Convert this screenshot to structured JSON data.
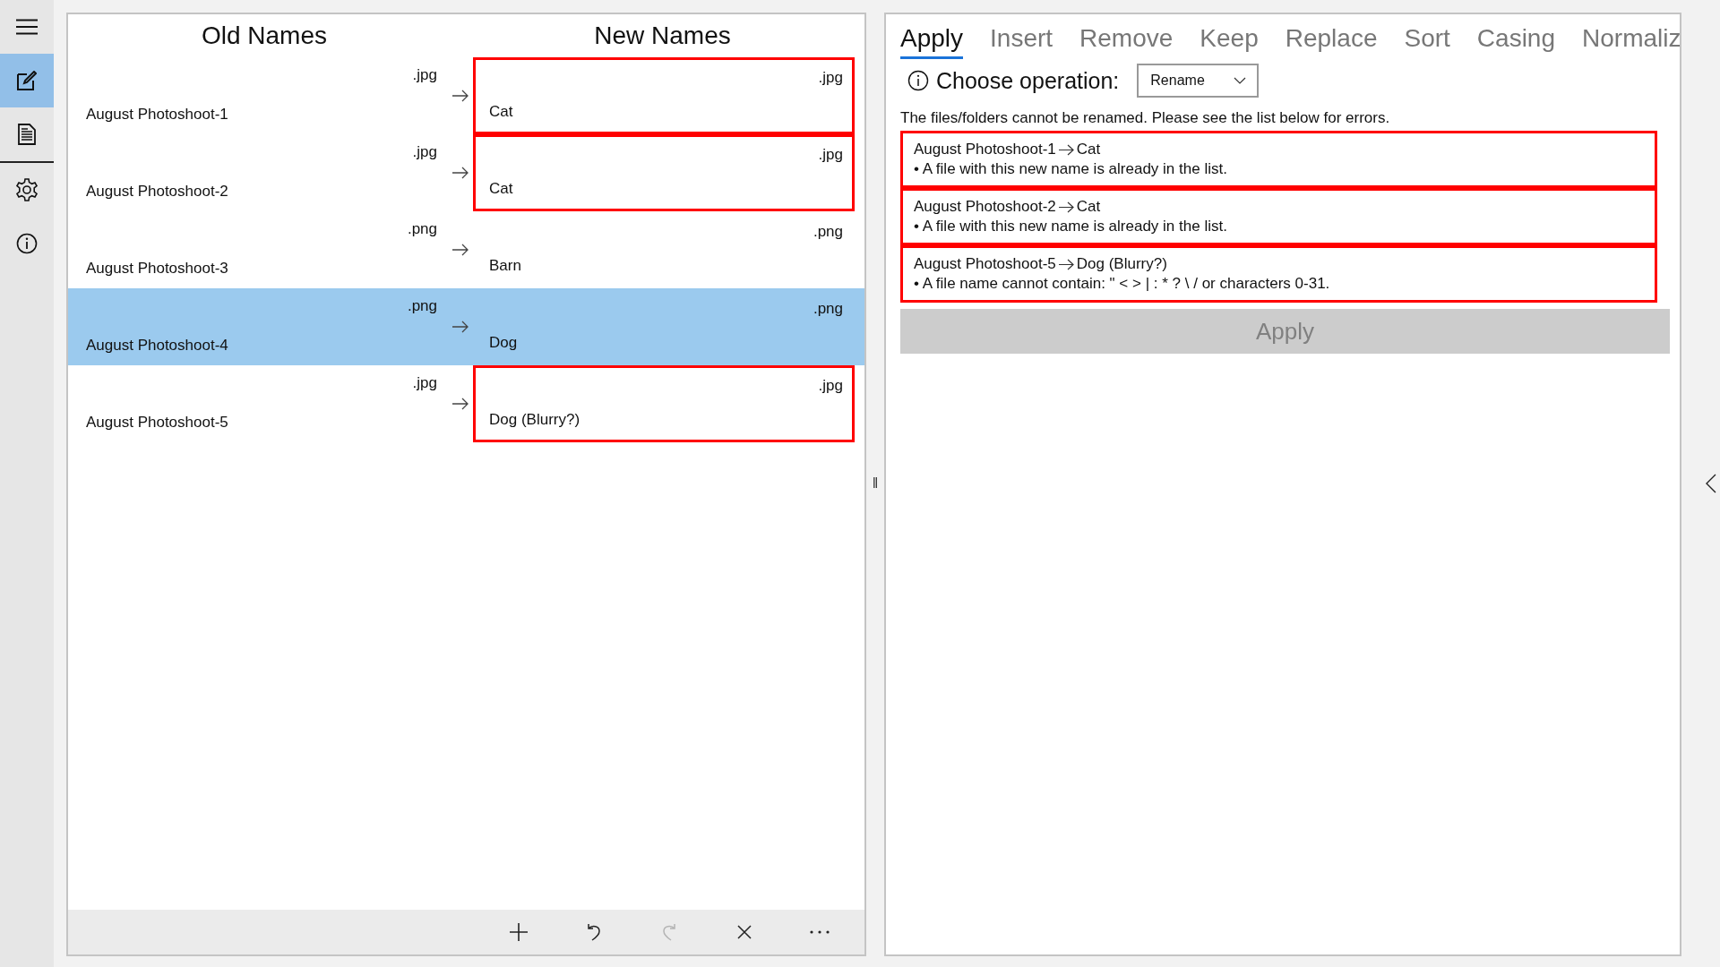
{
  "sidebar": {
    "items": [
      {
        "selected": true
      },
      {
        "selected": false
      },
      {
        "selected": false
      },
      {
        "selected": false
      }
    ]
  },
  "names": {
    "old_heading": "Old Names",
    "new_heading": "New Names",
    "rows": [
      {
        "old_name": "August Photoshoot-1",
        "old_ext": ".jpg",
        "new_name": "Cat",
        "new_ext": ".jpg",
        "error": true,
        "selected": false
      },
      {
        "old_name": "August Photoshoot-2",
        "old_ext": ".jpg",
        "new_name": "Cat",
        "new_ext": ".jpg",
        "error": true,
        "selected": false
      },
      {
        "old_name": "August Photoshoot-3",
        "old_ext": ".png",
        "new_name": "Barn",
        "new_ext": ".png",
        "error": false,
        "selected": false
      },
      {
        "old_name": "August Photoshoot-4",
        "old_ext": ".png",
        "new_name": "Dog",
        "new_ext": ".png",
        "error": false,
        "selected": true
      },
      {
        "old_name": "August Photoshoot-5",
        "old_ext": ".jpg",
        "new_name": "Dog (Blurry?)",
        "new_ext": ".jpg",
        "error": true,
        "selected": false
      }
    ],
    "toolbar": [
      {
        "disabled": false
      },
      {
        "disabled": false
      },
      {
        "disabled": true
      },
      {
        "disabled": false
      },
      {
        "disabled": false
      }
    ]
  },
  "splitter": "‖",
  "tabs": [
    {
      "label": "Apply",
      "selected": true
    },
    {
      "label": "Insert",
      "selected": false
    },
    {
      "label": "Remove",
      "selected": false
    },
    {
      "label": "Keep",
      "selected": false
    },
    {
      "label": "Replace",
      "selected": false
    },
    {
      "label": "Sort",
      "selected": false
    },
    {
      "label": "Casing",
      "selected": false
    },
    {
      "label": "Normaliz",
      "selected": false
    }
  ],
  "operation": {
    "label": "Choose operation:",
    "value": "Rename"
  },
  "message": "The files/folders cannot be renamed. Please see the list below for errors.",
  "errors": [
    {
      "old_name": "August Photoshoot-1",
      "new_name": "Cat",
      "reason": "• A file with this new name is already in the list."
    },
    {
      "old_name": "August Photoshoot-2",
      "new_name": "Cat",
      "reason": "• A file with this new name is already in the list."
    },
    {
      "old_name": "August Photoshoot-5",
      "new_name": "Dog (Blurry?)",
      "reason": "• A file name cannot contain: \" < > | : * ? \\ / or characters 0-31."
    }
  ],
  "apply_button": {
    "label": "Apply",
    "disabled": true
  }
}
